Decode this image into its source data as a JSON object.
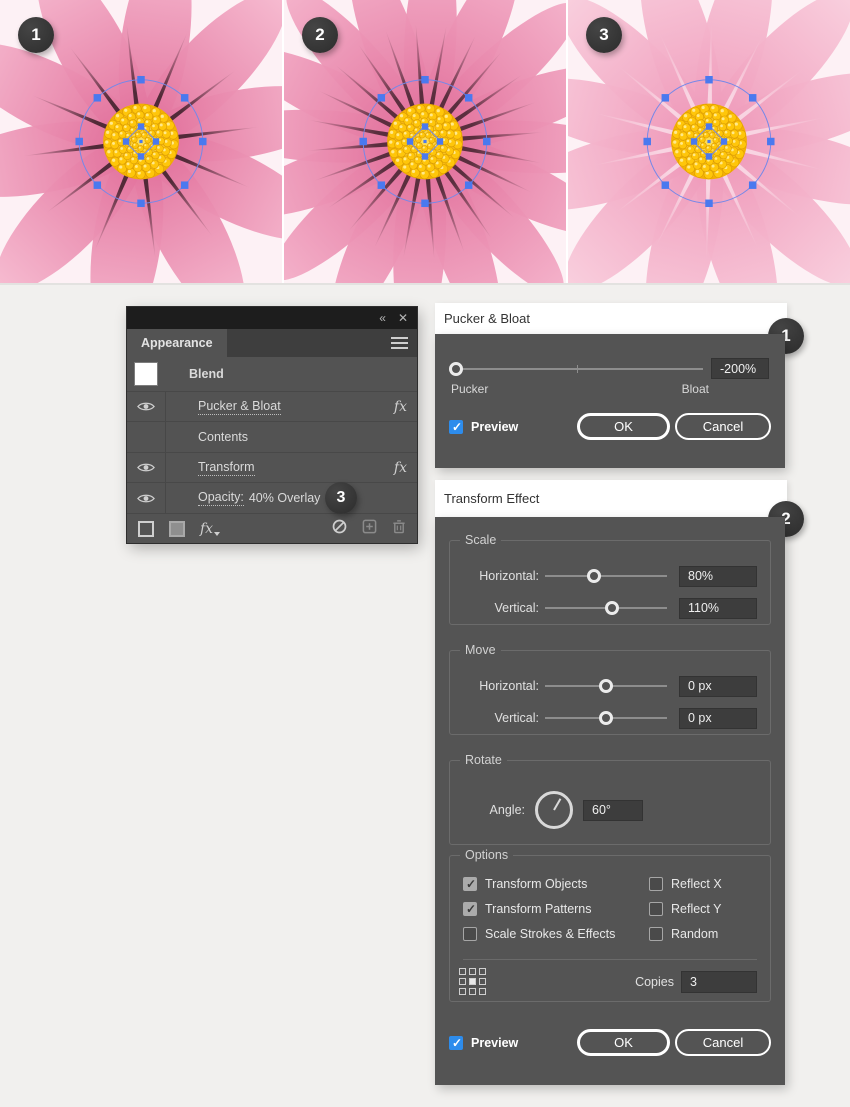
{
  "colors": {
    "accent_blue": "#2d8cec",
    "anchor_blue": "#4a79ef",
    "selection_stroke": "#7488e9",
    "panel_dark": "#535353",
    "petal_pink": "#ee86aa",
    "center_yellow": "#ffc60a",
    "badge_dark": "#333333"
  },
  "figures": [
    {
      "badge": "1",
      "petals": 10,
      "petal_w": 34,
      "spikes": 12,
      "spike_color": "#41212c",
      "spike_op": 0.9,
      "rot": 8,
      "inner": "#e06a97",
      "outer": "#f6b9cf"
    },
    {
      "badge": "2",
      "petals": 16,
      "petal_w": 26,
      "spikes": 24,
      "spike_color": "#41212c",
      "spike_op": 0.85,
      "rot": 3,
      "inner": "#e06a97",
      "outer": "#f4b0c9"
    },
    {
      "badge": "3",
      "petals": 12,
      "petal_w": 31,
      "spikes": 14,
      "spike_color": "#ffffff",
      "spike_op": 0.55,
      "rot": 14,
      "inner": "#ee94b6",
      "outer": "#f9cedd"
    }
  ],
  "appearance_panel": {
    "collapse_icon": "«",
    "close_icon": "✕",
    "tab": "Appearance",
    "rows": [
      {
        "label": "Blend"
      },
      {
        "label": "Pucker & Bloat",
        "fx": "fx"
      },
      {
        "label": "Contents"
      },
      {
        "label": "Transform",
        "fx": "fx"
      },
      {
        "label": "Opacity:",
        "value": "40% Overlay",
        "badge": "3"
      }
    ],
    "footer": {
      "fx_label": "fx"
    }
  },
  "pucker_dialog": {
    "title": "Pucker & Bloat",
    "badge": "1",
    "slider": {
      "left_label": "Pucker",
      "right_label": "Bloat",
      "value": "-200%",
      "pos": 2
    },
    "preview_label": "Preview",
    "preview_checked": true,
    "ok_label": "OK",
    "cancel_label": "Cancel"
  },
  "transform_dialog": {
    "title": "Transform Effect",
    "badge": "2",
    "scale": {
      "legend": "Scale",
      "rows": [
        {
          "label": "Horizontal:",
          "value": "80%",
          "pos": 40
        },
        {
          "label": "Vertical:",
          "value": "110%",
          "pos": 55
        }
      ]
    },
    "move": {
      "legend": "Move",
      "rows": [
        {
          "label": "Horizontal:",
          "value": "0 px",
          "pos": 50
        },
        {
          "label": "Vertical:",
          "value": "0 px",
          "pos": 50
        }
      ]
    },
    "rotate": {
      "legend": "Rotate",
      "angle_label": "Angle:",
      "value": "60°",
      "angle_deg": 60
    },
    "options": {
      "legend": "Options",
      "checkboxes": [
        {
          "label": "Transform Objects",
          "checked": true
        },
        {
          "label": "Reflect X",
          "checked": false
        },
        {
          "label": "Transform Patterns",
          "checked": true
        },
        {
          "label": "Reflect Y",
          "checked": false
        },
        {
          "label": "Scale Strokes & Effects",
          "checked": false
        },
        {
          "label": "Random",
          "checked": false
        }
      ],
      "copies_label": "Copies",
      "copies_value": "3"
    },
    "preview_label": "Preview",
    "preview_checked": true,
    "ok_label": "OK",
    "cancel_label": "Cancel"
  }
}
